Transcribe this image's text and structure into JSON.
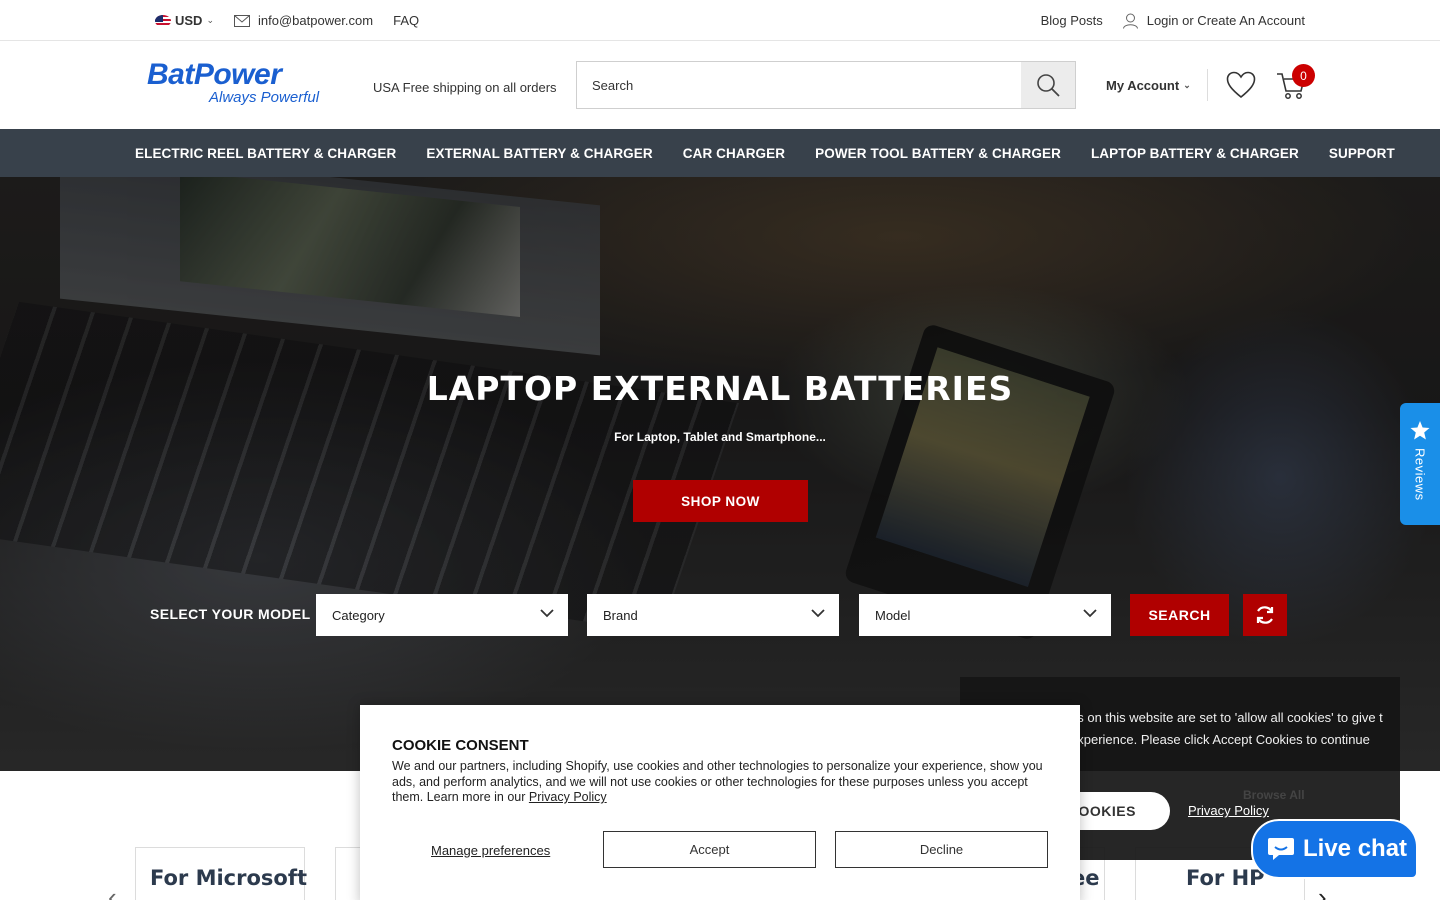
{
  "topbar": {
    "currency": "USD",
    "email": "info@batpower.com",
    "faq": "FAQ",
    "blog": "Blog Posts",
    "login": "Login or Create An Account"
  },
  "header": {
    "logo_main": "BatPower",
    "logo_sub": "Always Powerful",
    "shipping": "USA Free shipping on all orders",
    "search_placeholder": "Search",
    "my_account": "My Account",
    "cart_count": "0"
  },
  "nav": {
    "items": [
      "ELECTRIC REEL BATTERY & CHARGER",
      "EXTERNAL BATTERY & CHARGER",
      "CAR CHARGER",
      "POWER TOOL BATTERY & CHARGER",
      "LAPTOP BATTERY & CHARGER",
      "SUPPORT"
    ]
  },
  "hero": {
    "title": "LAPTOP EXTERNAL BATTERIES",
    "subtitle": "For Laptop, Tablet and Smartphone...",
    "button": "SHOP NOW"
  },
  "finder": {
    "label": "SELECT YOUR MODEL",
    "category": "Category",
    "brand": "Brand",
    "model": "Model",
    "search": "SEARCH"
  },
  "reviews_tab": "Reviews",
  "brands": {
    "items": [
      "For Microsoft",
      "ee",
      "For HP"
    ]
  },
  "dark_cookie": {
    "text": "gs on this website are set to 'allow all cookies' to give t experience. Please click Accept Cookies to continue",
    "browse": "Browse All",
    "accept": "COOKIES",
    "privacy": "Privacy Policy"
  },
  "consent": {
    "title": "COOKIE CONSENT",
    "text": "We and our partners, including Shopify, use cookies and other technologies to personalize your experience, show you ads, and perform analytics, and we will not use cookies or other technologies for these purposes unless you accept them. Learn more in our",
    "privacy_link": "Privacy Policy",
    "manage": "Manage preferences",
    "accept": "Accept",
    "decline": "Decline"
  },
  "livechat": "Live chat",
  "colors": {
    "brand_blue": "#1a5fd0",
    "nav_bg": "#38414b",
    "accent_red": "#b00000",
    "chat_blue": "#1473e6",
    "reviews_blue": "#1a8fe8"
  }
}
